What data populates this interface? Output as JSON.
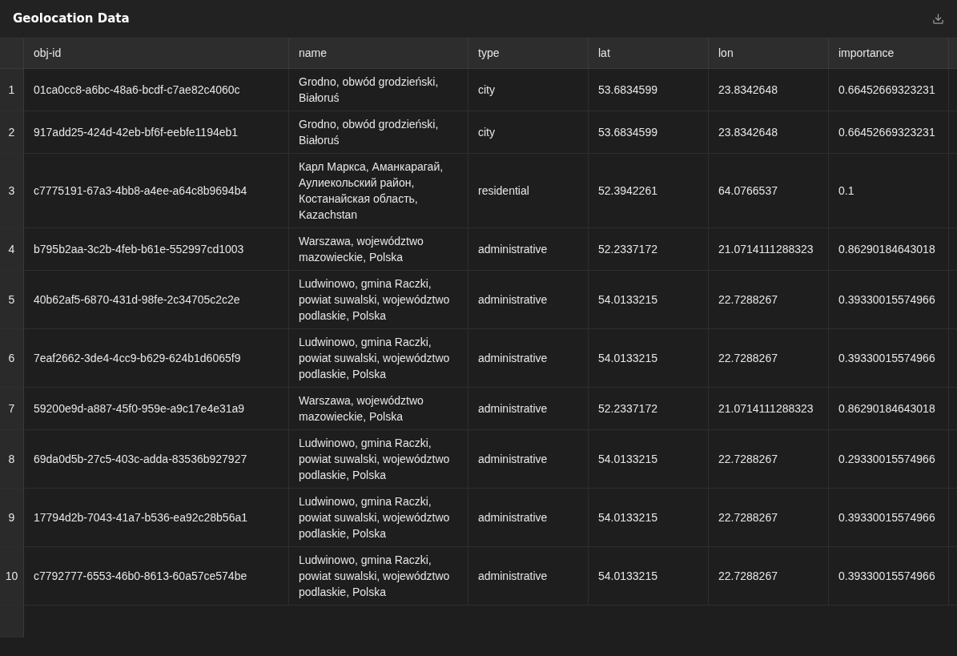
{
  "title": "Geolocation Data",
  "table": {
    "columns": [
      "obj-id",
      "name",
      "type",
      "lat",
      "lon",
      "importance"
    ],
    "rows": [
      {
        "index": "1",
        "cells": [
          "01ca0cc8-a6bc-48a6-bcdf-c7ae82c4060c",
          "Grodno, obwód grodzieński, Białoruś",
          "city",
          "53.6834599",
          "23.8342648",
          "0.66452669323231"
        ]
      },
      {
        "index": "2",
        "cells": [
          "917add25-424d-42eb-bf6f-eebfe1194eb1",
          "Grodno, obwód grodzieński, Białoruś",
          "city",
          "53.6834599",
          "23.8342648",
          "0.66452669323231"
        ]
      },
      {
        "index": "3",
        "cells": [
          "c7775191-67a3-4bb8-a4ee-a64c8b9694b4",
          "Карл Маркса, Аманкарагай, Аулиекольский район, Костанайская область, Kazachstan",
          "residential",
          "52.3942261",
          "64.0766537",
          "0.1"
        ]
      },
      {
        "index": "4",
        "cells": [
          "b795b2aa-3c2b-4feb-b61e-552997cd1003",
          "Warszawa, województwo mazowieckie, Polska",
          "administrative",
          "52.2337172",
          "21.0714111288323",
          "0.86290184643018"
        ]
      },
      {
        "index": "5",
        "cells": [
          "40b62af5-6870-431d-98fe-2c34705c2c2e",
          "Ludwinowo, gmina Raczki, powiat suwalski, województwo podlaskie, Polska",
          "administrative",
          "54.0133215",
          "22.7288267",
          "0.39330015574966"
        ]
      },
      {
        "index": "6",
        "cells": [
          "7eaf2662-3de4-4cc9-b629-624b1d6065f9",
          "Ludwinowo, gmina Raczki, powiat suwalski, województwo podlaskie, Polska",
          "administrative",
          "54.0133215",
          "22.7288267",
          "0.39330015574966"
        ]
      },
      {
        "index": "7",
        "cells": [
          "59200e9d-a887-45f0-959e-a9c17e4e31a9",
          "Warszawa, województwo mazowieckie, Polska",
          "administrative",
          "52.2337172",
          "21.0714111288323",
          "0.86290184643018"
        ]
      },
      {
        "index": "8",
        "cells": [
          "69da0d5b-27c5-403c-adda-83536b927927",
          "Ludwinowo, gmina Raczki, powiat suwalski, województwo podlaskie, Polska",
          "administrative",
          "54.0133215",
          "22.7288267",
          "0.29330015574966"
        ]
      },
      {
        "index": "9",
        "cells": [
          "17794d2b-7043-41a7-b536-ea92c28b56a1",
          "Ludwinowo, gmina Raczki, powiat suwalski, województwo podlaskie, Polska",
          "administrative",
          "54.0133215",
          "22.7288267",
          "0.39330015574966"
        ]
      },
      {
        "index": "10",
        "cells": [
          "c7792777-6553-46b0-8613-60a57ce574be",
          "Ludwinowo, gmina Raczki, powiat suwalski, województwo podlaskie, Polska",
          "administrative",
          "54.0133215",
          "22.7288267",
          "0.39330015574966"
        ]
      }
    ]
  }
}
